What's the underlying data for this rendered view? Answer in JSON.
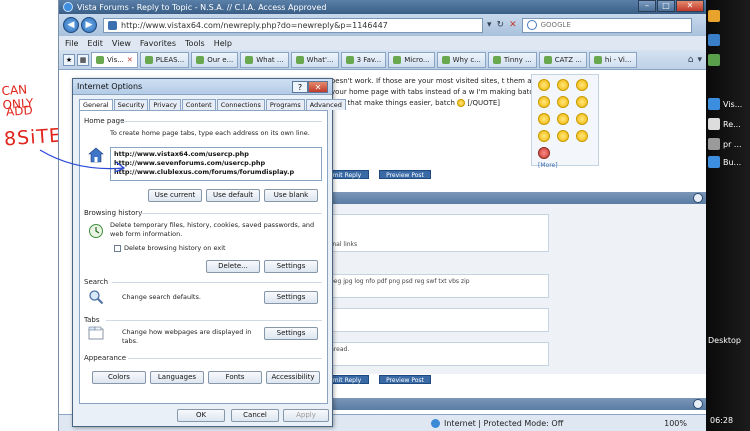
{
  "annotation": {
    "line1": "CAN ONLY",
    "line2": "ADD",
    "line3": "8SiTES",
    "color": "#e0241b"
  },
  "browser": {
    "title": "Vista Forums - Reply to Topic - N.S.A. // C.I.A. Access Approved",
    "url": "http://www.vistax64.com/newreply.php?do=newreply&p=1146447",
    "search_placeholder": "GOOGLE",
    "menu": [
      "File",
      "Edit",
      "View",
      "Favorites",
      "Tools",
      "Help"
    ],
    "tabs": [
      {
        "label": "Vis...",
        "active": true
      },
      {
        "label": "PLEAS..."
      },
      {
        "label": "Our e..."
      },
      {
        "label": "What ..."
      },
      {
        "label": "What'..."
      },
      {
        "label": "3 Fav..."
      },
      {
        "label": "Micro..."
      },
      {
        "label": "Why c..."
      },
      {
        "label": "Tinny ..."
      },
      {
        "label": "CATZ ..."
      },
      {
        "label": "hi - Vi..."
      }
    ]
  },
  "content": {
    "forum_text": "oesn't work. If those are your most visited sites, t them as your home page with tabs instead of a w I'm making batch files that make things easier, batch",
    "quote_end": "[/QUOTE]",
    "more_link": "[More]",
    "submit_label": "mit Reply",
    "preview_label": "Preview Post",
    "field1": "rnal links",
    "field2": "peg jpg log nfo pdf png psd reg swf txt vbs zip",
    "field3": "hread."
  },
  "statusbar": {
    "zone": "Internet | Protected Mode: Off",
    "zoom": "100%"
  },
  "sidebar": {
    "items": [
      "Vis...",
      "Re...",
      "pr ...",
      "Bu..."
    ],
    "desktop": "Desktop",
    "clock": "06:28"
  },
  "dialog": {
    "title": "Internet Options",
    "tabs": [
      "General",
      "Security",
      "Privacy",
      "Content",
      "Connections",
      "Programs",
      "Advanced"
    ],
    "home_page": {
      "heading": "Home page",
      "description": "To create home page tabs, type each address on its own line.",
      "urls": [
        "http://www.vistax64.com/usercp.php",
        "http://www.sevenforums.com/usercp.php",
        "http://www.clublexus.com/forums/forumdisplay.p"
      ],
      "btn_current": "Use current",
      "btn_default": "Use default",
      "btn_blank": "Use blank"
    },
    "browsing_history": {
      "heading": "Browsing history",
      "description": "Delete temporary files, history, cookies, saved passwords, and web form information.",
      "checkbox_label": "Delete browsing history on exit",
      "btn_delete": "Delete...",
      "btn_settings": "Settings"
    },
    "search": {
      "heading": "Search",
      "description": "Change search defaults.",
      "btn_settings": "Settings"
    },
    "tabs_group": {
      "heading": "Tabs",
      "description": "Change how webpages are displayed in tabs.",
      "btn_settings": "Settings"
    },
    "appearance": {
      "heading": "Appearance",
      "btn_colors": "Colors",
      "btn_languages": "Languages",
      "btn_fonts": "Fonts",
      "btn_accessibility": "Accessibility"
    },
    "footer": {
      "ok": "OK",
      "cancel": "Cancel",
      "apply": "Apply"
    }
  }
}
